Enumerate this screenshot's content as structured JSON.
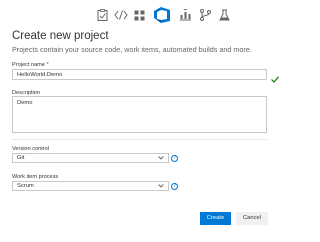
{
  "nav": {
    "icons": [
      "dashboard-icon",
      "code-icon",
      "work-items-icon",
      "azure-devops-icon",
      "pipelines-icon",
      "git-branch-icon",
      "test-flask-icon"
    ],
    "active": "azure-devops-icon",
    "accent": "#0078d4"
  },
  "header": {
    "title": "Create new project",
    "subtitle": "Projects contain your source code, work items, automated builds and more."
  },
  "form": {
    "project_name": {
      "label": "Project name",
      "required_marker": "*",
      "value": "HelloWorld.Demo",
      "valid": true
    },
    "description": {
      "label": "Description",
      "value": "Demo"
    },
    "version_control": {
      "label": "Version control",
      "value": "Git"
    },
    "work_item_process": {
      "label": "Work item process",
      "value": "Scrum"
    }
  },
  "actions": {
    "create_label": "Create",
    "cancel_label": "Cancel"
  },
  "colors": {
    "primary": "#0078d4",
    "success": "#107c10"
  }
}
